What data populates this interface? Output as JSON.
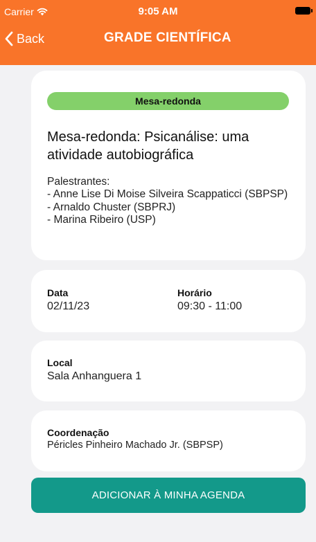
{
  "status_bar": {
    "carrier": "Carrier",
    "time": "9:05 AM"
  },
  "nav": {
    "back_label": "Back",
    "title": "GRADE CIENTÍFICA"
  },
  "event": {
    "badge": "Mesa-redonda",
    "title": "Mesa-redonda: Psicanálise: uma atividade autobiográfica",
    "speakers_label": "Palestrantes:",
    "speakers": [
      "- Anne Lise Di Moise Silveira Scappaticci (SBPSP)",
      "- Arnaldo Chuster (SBPRJ)",
      "- Marina Ribeiro (USP)"
    ]
  },
  "schedule": {
    "date_label": "Data",
    "date_value": "02/11/23",
    "time_label": "Horário",
    "time_value": "09:30 - 11:00"
  },
  "location": {
    "label": "Local",
    "value": "Sala Anhanguera 1"
  },
  "coordination": {
    "label": "Coordenação",
    "value": "Péricles Pinheiro Machado Jr. (SBPSP)"
  },
  "actions": {
    "add_to_agenda": "ADICIONAR À MINHA AGENDA"
  },
  "colors": {
    "header": "#f97429",
    "badge": "#84d06a",
    "button": "#13998a",
    "background": "#f2f2f4"
  }
}
